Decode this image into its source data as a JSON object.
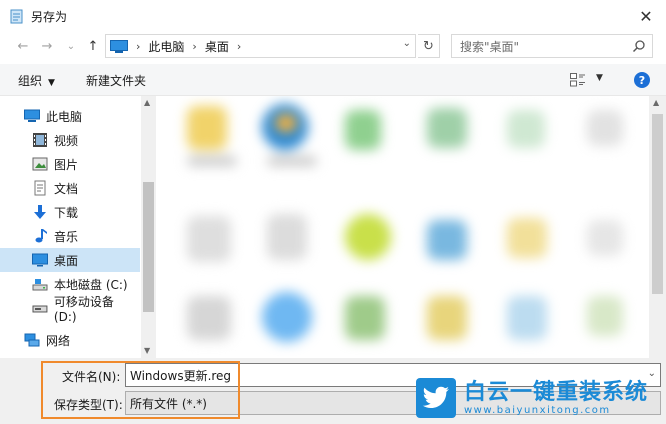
{
  "window": {
    "title": "另存为",
    "close_glyph": "✕"
  },
  "nav": {
    "back": "←",
    "forward": "→",
    "dropdown": "⌄",
    "up": "↑"
  },
  "address": {
    "crumbs": [
      "此电脑",
      "桌面"
    ],
    "sep": "›",
    "refresh": "↻"
  },
  "search": {
    "placeholder": "搜索\"桌面\""
  },
  "toolbar": {
    "organize": "组织",
    "caret": "▼",
    "new_folder": "新建文件夹",
    "help": "?"
  },
  "sidebar": {
    "items": [
      {
        "label": "此电脑",
        "icon": "computer-icon"
      },
      {
        "label": "视频",
        "icon": "video-icon"
      },
      {
        "label": "图片",
        "icon": "pictures-icon"
      },
      {
        "label": "文档",
        "icon": "documents-icon"
      },
      {
        "label": "下载",
        "icon": "download-icon"
      },
      {
        "label": "音乐",
        "icon": "music-icon"
      },
      {
        "label": "桌面",
        "icon": "desktop-icon",
        "selected": true
      },
      {
        "label": "本地磁盘 (C:)",
        "icon": "drive-icon"
      },
      {
        "label": "可移动设备 (D:)",
        "icon": "removable-drive-icon"
      },
      {
        "label": "网络",
        "icon": "network-icon"
      }
    ]
  },
  "fields": {
    "filename_label": "文件名(N):",
    "filename_value": "Windows更新.reg",
    "filetype_label": "保存类型(T):",
    "filetype_value": "所有文件 (*.*)"
  },
  "watermark": {
    "title": "白云一键重装系统",
    "url": "www.baiyunxitong.com"
  },
  "colors": {
    "accent": "#1c6fd6",
    "selected": "#cce4f7",
    "highlight": "#f08a2c",
    "watermark": "#1b8ad6"
  }
}
